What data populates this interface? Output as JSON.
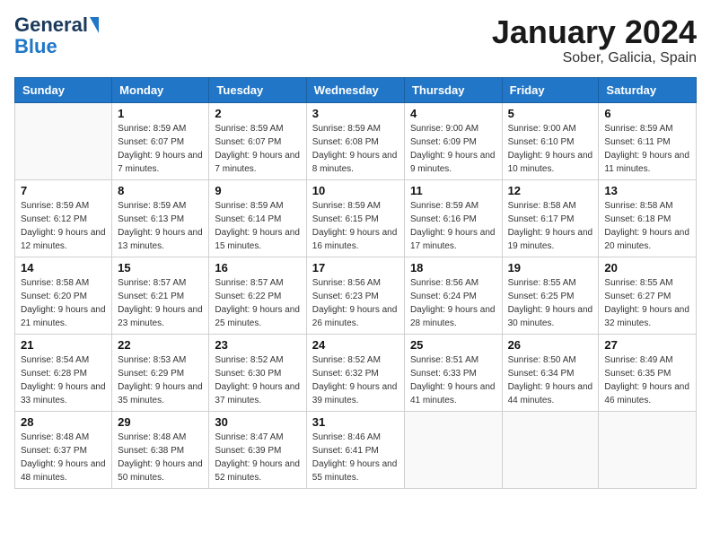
{
  "logo": {
    "line1": "General",
    "line2": "Blue"
  },
  "title": "January 2024",
  "subtitle": "Sober, Galicia, Spain",
  "days_header": [
    "Sunday",
    "Monday",
    "Tuesday",
    "Wednesday",
    "Thursday",
    "Friday",
    "Saturday"
  ],
  "weeks": [
    [
      {
        "num": "",
        "sunrise": "",
        "sunset": "",
        "daylight": ""
      },
      {
        "num": "1",
        "sunrise": "Sunrise: 8:59 AM",
        "sunset": "Sunset: 6:07 PM",
        "daylight": "Daylight: 9 hours and 7 minutes."
      },
      {
        "num": "2",
        "sunrise": "Sunrise: 8:59 AM",
        "sunset": "Sunset: 6:07 PM",
        "daylight": "Daylight: 9 hours and 7 minutes."
      },
      {
        "num": "3",
        "sunrise": "Sunrise: 8:59 AM",
        "sunset": "Sunset: 6:08 PM",
        "daylight": "Daylight: 9 hours and 8 minutes."
      },
      {
        "num": "4",
        "sunrise": "Sunrise: 9:00 AM",
        "sunset": "Sunset: 6:09 PM",
        "daylight": "Daylight: 9 hours and 9 minutes."
      },
      {
        "num": "5",
        "sunrise": "Sunrise: 9:00 AM",
        "sunset": "Sunset: 6:10 PM",
        "daylight": "Daylight: 9 hours and 10 minutes."
      },
      {
        "num": "6",
        "sunrise": "Sunrise: 8:59 AM",
        "sunset": "Sunset: 6:11 PM",
        "daylight": "Daylight: 9 hours and 11 minutes."
      }
    ],
    [
      {
        "num": "7",
        "sunrise": "Sunrise: 8:59 AM",
        "sunset": "Sunset: 6:12 PM",
        "daylight": "Daylight: 9 hours and 12 minutes."
      },
      {
        "num": "8",
        "sunrise": "Sunrise: 8:59 AM",
        "sunset": "Sunset: 6:13 PM",
        "daylight": "Daylight: 9 hours and 13 minutes."
      },
      {
        "num": "9",
        "sunrise": "Sunrise: 8:59 AM",
        "sunset": "Sunset: 6:14 PM",
        "daylight": "Daylight: 9 hours and 15 minutes."
      },
      {
        "num": "10",
        "sunrise": "Sunrise: 8:59 AM",
        "sunset": "Sunset: 6:15 PM",
        "daylight": "Daylight: 9 hours and 16 minutes."
      },
      {
        "num": "11",
        "sunrise": "Sunrise: 8:59 AM",
        "sunset": "Sunset: 6:16 PM",
        "daylight": "Daylight: 9 hours and 17 minutes."
      },
      {
        "num": "12",
        "sunrise": "Sunrise: 8:58 AM",
        "sunset": "Sunset: 6:17 PM",
        "daylight": "Daylight: 9 hours and 19 minutes."
      },
      {
        "num": "13",
        "sunrise": "Sunrise: 8:58 AM",
        "sunset": "Sunset: 6:18 PM",
        "daylight": "Daylight: 9 hours and 20 minutes."
      }
    ],
    [
      {
        "num": "14",
        "sunrise": "Sunrise: 8:58 AM",
        "sunset": "Sunset: 6:20 PM",
        "daylight": "Daylight: 9 hours and 21 minutes."
      },
      {
        "num": "15",
        "sunrise": "Sunrise: 8:57 AM",
        "sunset": "Sunset: 6:21 PM",
        "daylight": "Daylight: 9 hours and 23 minutes."
      },
      {
        "num": "16",
        "sunrise": "Sunrise: 8:57 AM",
        "sunset": "Sunset: 6:22 PM",
        "daylight": "Daylight: 9 hours and 25 minutes."
      },
      {
        "num": "17",
        "sunrise": "Sunrise: 8:56 AM",
        "sunset": "Sunset: 6:23 PM",
        "daylight": "Daylight: 9 hours and 26 minutes."
      },
      {
        "num": "18",
        "sunrise": "Sunrise: 8:56 AM",
        "sunset": "Sunset: 6:24 PM",
        "daylight": "Daylight: 9 hours and 28 minutes."
      },
      {
        "num": "19",
        "sunrise": "Sunrise: 8:55 AM",
        "sunset": "Sunset: 6:25 PM",
        "daylight": "Daylight: 9 hours and 30 minutes."
      },
      {
        "num": "20",
        "sunrise": "Sunrise: 8:55 AM",
        "sunset": "Sunset: 6:27 PM",
        "daylight": "Daylight: 9 hours and 32 minutes."
      }
    ],
    [
      {
        "num": "21",
        "sunrise": "Sunrise: 8:54 AM",
        "sunset": "Sunset: 6:28 PM",
        "daylight": "Daylight: 9 hours and 33 minutes."
      },
      {
        "num": "22",
        "sunrise": "Sunrise: 8:53 AM",
        "sunset": "Sunset: 6:29 PM",
        "daylight": "Daylight: 9 hours and 35 minutes."
      },
      {
        "num": "23",
        "sunrise": "Sunrise: 8:52 AM",
        "sunset": "Sunset: 6:30 PM",
        "daylight": "Daylight: 9 hours and 37 minutes."
      },
      {
        "num": "24",
        "sunrise": "Sunrise: 8:52 AM",
        "sunset": "Sunset: 6:32 PM",
        "daylight": "Daylight: 9 hours and 39 minutes."
      },
      {
        "num": "25",
        "sunrise": "Sunrise: 8:51 AM",
        "sunset": "Sunset: 6:33 PM",
        "daylight": "Daylight: 9 hours and 41 minutes."
      },
      {
        "num": "26",
        "sunrise": "Sunrise: 8:50 AM",
        "sunset": "Sunset: 6:34 PM",
        "daylight": "Daylight: 9 hours and 44 minutes."
      },
      {
        "num": "27",
        "sunrise": "Sunrise: 8:49 AM",
        "sunset": "Sunset: 6:35 PM",
        "daylight": "Daylight: 9 hours and 46 minutes."
      }
    ],
    [
      {
        "num": "28",
        "sunrise": "Sunrise: 8:48 AM",
        "sunset": "Sunset: 6:37 PM",
        "daylight": "Daylight: 9 hours and 48 minutes."
      },
      {
        "num": "29",
        "sunrise": "Sunrise: 8:48 AM",
        "sunset": "Sunset: 6:38 PM",
        "daylight": "Daylight: 9 hours and 50 minutes."
      },
      {
        "num": "30",
        "sunrise": "Sunrise: 8:47 AM",
        "sunset": "Sunset: 6:39 PM",
        "daylight": "Daylight: 9 hours and 52 minutes."
      },
      {
        "num": "31",
        "sunrise": "Sunrise: 8:46 AM",
        "sunset": "Sunset: 6:41 PM",
        "daylight": "Daylight: 9 hours and 55 minutes."
      },
      {
        "num": "",
        "sunrise": "",
        "sunset": "",
        "daylight": ""
      },
      {
        "num": "",
        "sunrise": "",
        "sunset": "",
        "daylight": ""
      },
      {
        "num": "",
        "sunrise": "",
        "sunset": "",
        "daylight": ""
      }
    ]
  ]
}
